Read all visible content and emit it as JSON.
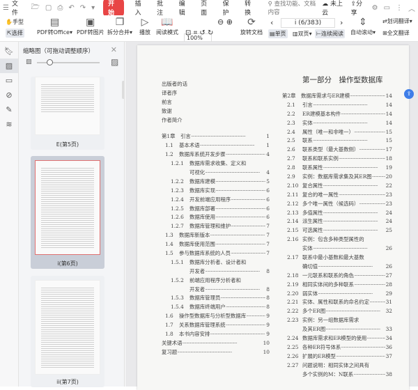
{
  "menu": {
    "file": "文件",
    "tabs": [
      "开始",
      "插入",
      "批注",
      "编辑",
      "页面",
      "保护",
      "转换"
    ],
    "search": "查找功能、文档内容",
    "cloud": "未上云",
    "share": "分享"
  },
  "toolbar": {
    "hand": "手型",
    "select": "选择",
    "pdf_office": "PDF转Office",
    "pdf_image": "PDF转图片",
    "split": "拆分合并",
    "play": "播放",
    "read": "阅读模式",
    "zoom": "100%",
    "rotate": "旋转文档",
    "page": "i (6/383)",
    "single": "单页",
    "double": "双页",
    "continuous": "连续阅读",
    "autoscroll": "自动滚动",
    "translate_word": "划词翻译",
    "translate_all": "全文翻译"
  },
  "panel": {
    "title": "缩略图（可拖动调整顺序）",
    "zoom_fraction": 0.2,
    "thumbs": [
      "E(第5页)",
      "i(第6页)",
      "ii(第7页)"
    ]
  },
  "toc_left": [
    {
      "n": "",
      "t": "出版者的话",
      "p": "",
      "lv": 0
    },
    {
      "n": "",
      "t": "译者序",
      "p": "",
      "lv": 0
    },
    {
      "n": "",
      "t": "前言",
      "p": "",
      "lv": 0
    },
    {
      "n": "",
      "t": "致谢",
      "p": "",
      "lv": 0
    },
    {
      "n": "",
      "t": "作者简介",
      "p": "",
      "lv": 0
    },
    {
      "gap": 1
    },
    {
      "n": "第1章",
      "t": "引言",
      "p": "1",
      "lv": 0
    },
    {
      "n": "1.1",
      "t": "基本术语",
      "p": "1",
      "lv": 1
    },
    {
      "n": "1.2",
      "t": "数据库系统开发步骤",
      "p": "4",
      "lv": 1
    },
    {
      "n": "1.2.1",
      "t": "数据库需求收集、定义和",
      "p": "",
      "lv": 2
    },
    {
      "n": "",
      "t": "可视化",
      "p": "4",
      "lv": 3
    },
    {
      "n": "1.2.2",
      "t": "数据库建模",
      "p": "5",
      "lv": 2
    },
    {
      "n": "1.2.3",
      "t": "数据库实现",
      "p": "6",
      "lv": 2
    },
    {
      "n": "1.2.4",
      "t": "开发前端应用程序",
      "p": "6",
      "lv": 2
    },
    {
      "n": "1.2.5",
      "t": "数据库部署",
      "p": "6",
      "lv": 2
    },
    {
      "n": "1.2.6",
      "t": "数据库使用",
      "p": "6",
      "lv": 2
    },
    {
      "n": "1.2.7",
      "t": "数据库管理和维护",
      "p": "7",
      "lv": 2
    },
    {
      "n": "1.3",
      "t": "数据库新版本",
      "p": "7",
      "lv": 1
    },
    {
      "n": "1.4",
      "t": "数据库使用范围",
      "p": "7",
      "lv": 1
    },
    {
      "n": "1.5",
      "t": "参与数据库系统的人员",
      "p": "7",
      "lv": 1
    },
    {
      "n": "1.5.1",
      "t": "数据库分析者、设计者和",
      "p": "",
      "lv": 2
    },
    {
      "n": "",
      "t": "开发者",
      "p": "8",
      "lv": 3
    },
    {
      "n": "1.5.2",
      "t": "前端应用程序分析者和",
      "p": "",
      "lv": 2
    },
    {
      "n": "",
      "t": "开发者",
      "p": "8",
      "lv": 3
    },
    {
      "n": "1.5.3",
      "t": "数据库管理员",
      "p": "8",
      "lv": 2
    },
    {
      "n": "1.5.4",
      "t": "数据库终端用户",
      "p": "8",
      "lv": 2
    },
    {
      "n": "1.6",
      "t": "操作型数据库与分析型数据库",
      "p": "9",
      "lv": 1
    },
    {
      "n": "1.7",
      "t": "关系数据库管理系统",
      "p": "9",
      "lv": 1
    },
    {
      "n": "1.8",
      "t": "本书内容安排",
      "p": "9",
      "lv": 1
    },
    {
      "n": "",
      "t": "关键术语",
      "p": "10",
      "lv": 0
    },
    {
      "n": "",
      "t": "复习题",
      "p": "10",
      "lv": 0
    }
  ],
  "part_title": "第一部分　操作型数据库",
  "toc_right": [
    {
      "n": "第2章",
      "t": "数据库需求与ER建模",
      "p": "14"
    },
    {
      "n": "2.1",
      "t": "引言",
      "p": "14"
    },
    {
      "n": "2.2",
      "t": "ER建模基本构件",
      "p": "14"
    },
    {
      "n": "2.3",
      "t": "实体",
      "p": "14"
    },
    {
      "n": "2.4",
      "t": "属性（唯一和非唯一）",
      "p": "15"
    },
    {
      "n": "2.5",
      "t": "联系",
      "p": "15"
    },
    {
      "n": "2.6",
      "t": "联系类型（最大基数侧）",
      "p": "17"
    },
    {
      "n": "2.7",
      "t": "联系和联系实例",
      "p": "18"
    },
    {
      "n": "2.8",
      "t": "联系属性",
      "p": "19"
    },
    {
      "n": "2.9",
      "t": "实例：数据库需求集及其ER图",
      "p": "20"
    },
    {
      "n": "2.10",
      "t": "复合属性",
      "p": "22"
    },
    {
      "n": "2.11",
      "t": "复合的唯一属性",
      "p": "23"
    },
    {
      "n": "2.12",
      "t": "多个唯一属性（候选码）",
      "p": "23"
    },
    {
      "n": "2.13",
      "t": "多值属性",
      "p": "24"
    },
    {
      "n": "2.14",
      "t": "派生属性",
      "p": "24"
    },
    {
      "n": "2.15",
      "t": "可选属性",
      "p": "25"
    },
    {
      "n": "2.16",
      "t": "实例：包含多种类型属性的",
      "p": ""
    },
    {
      "n": "",
      "t": "实体",
      "p": "26"
    },
    {
      "n": "2.17",
      "t": "联系中最小基数和最大基数",
      "p": ""
    },
    {
      "n": "",
      "t": "确切值",
      "p": "26"
    },
    {
      "n": "2.18",
      "t": "一元联系和联系的角色",
      "p": "27"
    },
    {
      "n": "2.19",
      "t": "相同实体间的多种联系",
      "p": "28"
    },
    {
      "n": "2.20",
      "t": "弱实体",
      "p": "29"
    },
    {
      "n": "2.21",
      "t": "实体、属性和联系的命名约定",
      "p": "31"
    },
    {
      "n": "2.22",
      "t": "多个ER图",
      "p": "32"
    },
    {
      "n": "2.23",
      "t": "实例：另一组数据库需求",
      "p": ""
    },
    {
      "n": "",
      "t": "及其ER图",
      "p": "33"
    },
    {
      "n": "2.24",
      "t": "数据库需求和ER模型的使用",
      "p": "34"
    },
    {
      "n": "2.25",
      "t": "各种ER符号体系",
      "p": "36"
    },
    {
      "n": "2.26",
      "t": "扩展的ER模型",
      "p": "37"
    },
    {
      "n": "2.27",
      "t": "问题说明：相同实体之间具有",
      "p": ""
    },
    {
      "n": "",
      "t": "多个实例的M：N联系",
      "p": "38"
    }
  ]
}
